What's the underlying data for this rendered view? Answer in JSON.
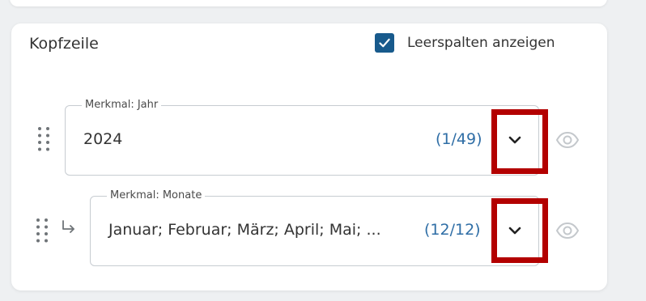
{
  "panel": {
    "title": "Kopfzeile",
    "show_empty_columns": {
      "label": "Leerspalten anzeigen",
      "checked": true
    }
  },
  "rows": [
    {
      "label": "Merkmal: Jahr",
      "value": "2024",
      "count": "(1/49)",
      "nested": false
    },
    {
      "label": "Merkmal: Monate",
      "value": "Januar; Februar; März; April; Mai; ...",
      "count": "(12/12)",
      "nested": true
    }
  ],
  "icons": {
    "drag": "drag-handle-icon",
    "nested": "subdirectory-arrow-icon",
    "dropdown": "chevron-down-icon",
    "visibility": "eye-icon",
    "check": "check-icon"
  },
  "colors": {
    "accent": "#185a8c",
    "count_text": "#2f6ea6",
    "highlight": "#b30000",
    "muted_icon": "#c4c8cc"
  }
}
